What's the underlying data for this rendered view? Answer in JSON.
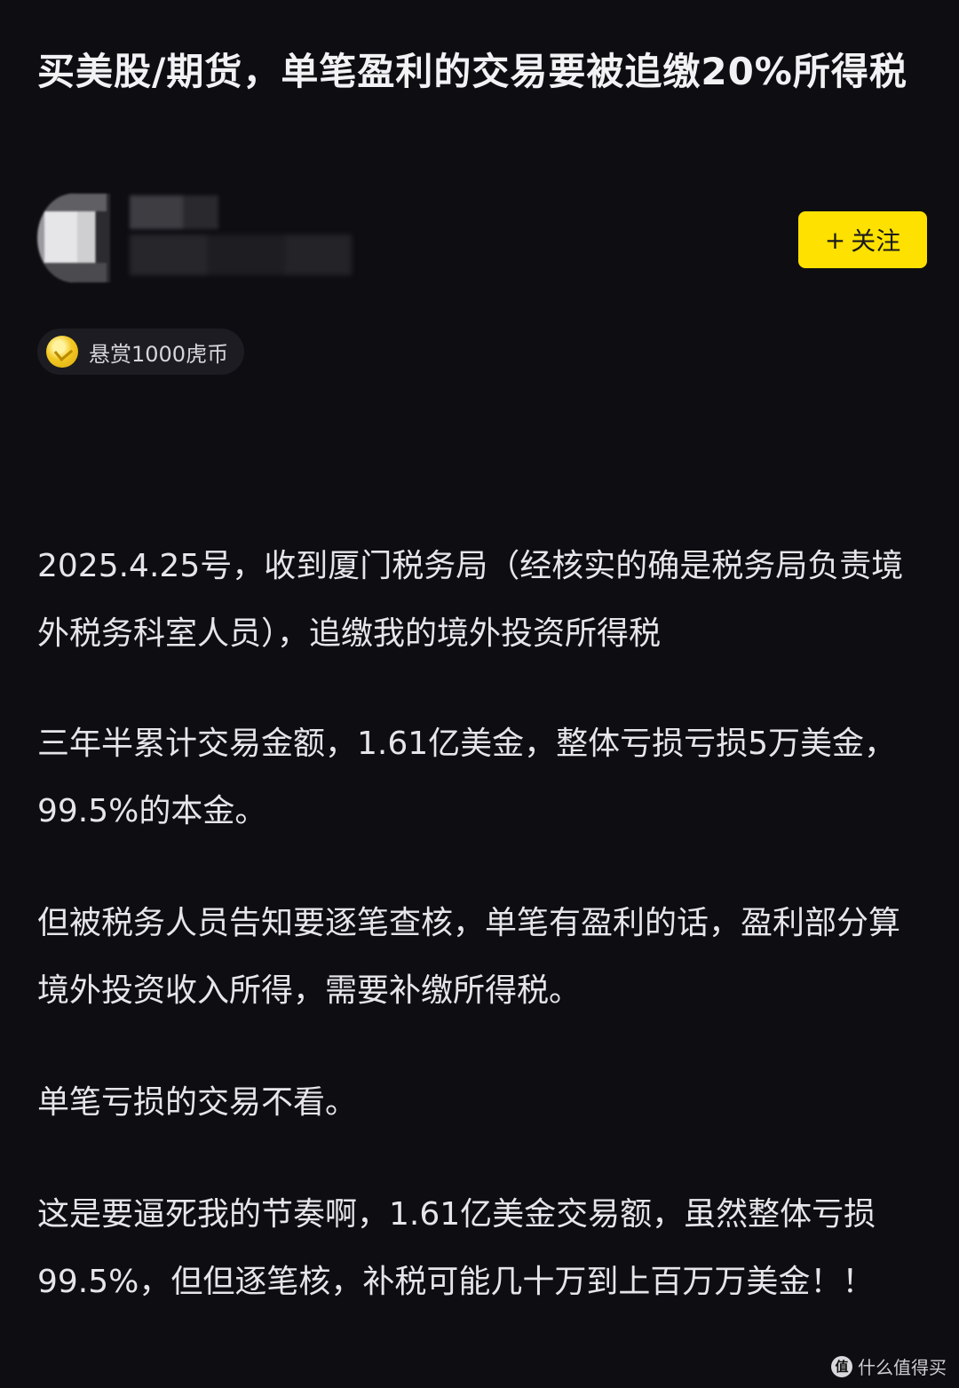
{
  "post": {
    "title": "买美股/期货，单笔盈利的交易要被追缴20%所得税"
  },
  "author": {
    "name": "",
    "meta": ""
  },
  "follow": {
    "plus": "+",
    "label": "关注"
  },
  "bounty": {
    "label": "悬赏1000虎币"
  },
  "content": {
    "paragraphs": [
      "2025.4.25号，收到厦门税务局（经核实的确是税务局负责境外税务科室人员），追缴我的境外投资所得税",
      "三年半累计交易金额，1.61亿美金，整体亏损亏损5万美金，99.5%的本金。",
      "但被税务人员告知要逐笔查核，单笔有盈利的话，盈利部分算境外投资收入所得，需要补缴所得税。",
      "单笔亏损的交易不看。",
      "这是要逼死我的节奏啊，1.61亿美金交易额，虽然整体亏损99.5%，但但逐笔核，补税可能几十万到上百万万美金！！"
    ]
  },
  "watermark": {
    "logo": "值",
    "text": "什么值得买"
  },
  "colors": {
    "background": "#0e0e12",
    "follow_button": "#ffe100",
    "text": "#e6e6ea"
  }
}
